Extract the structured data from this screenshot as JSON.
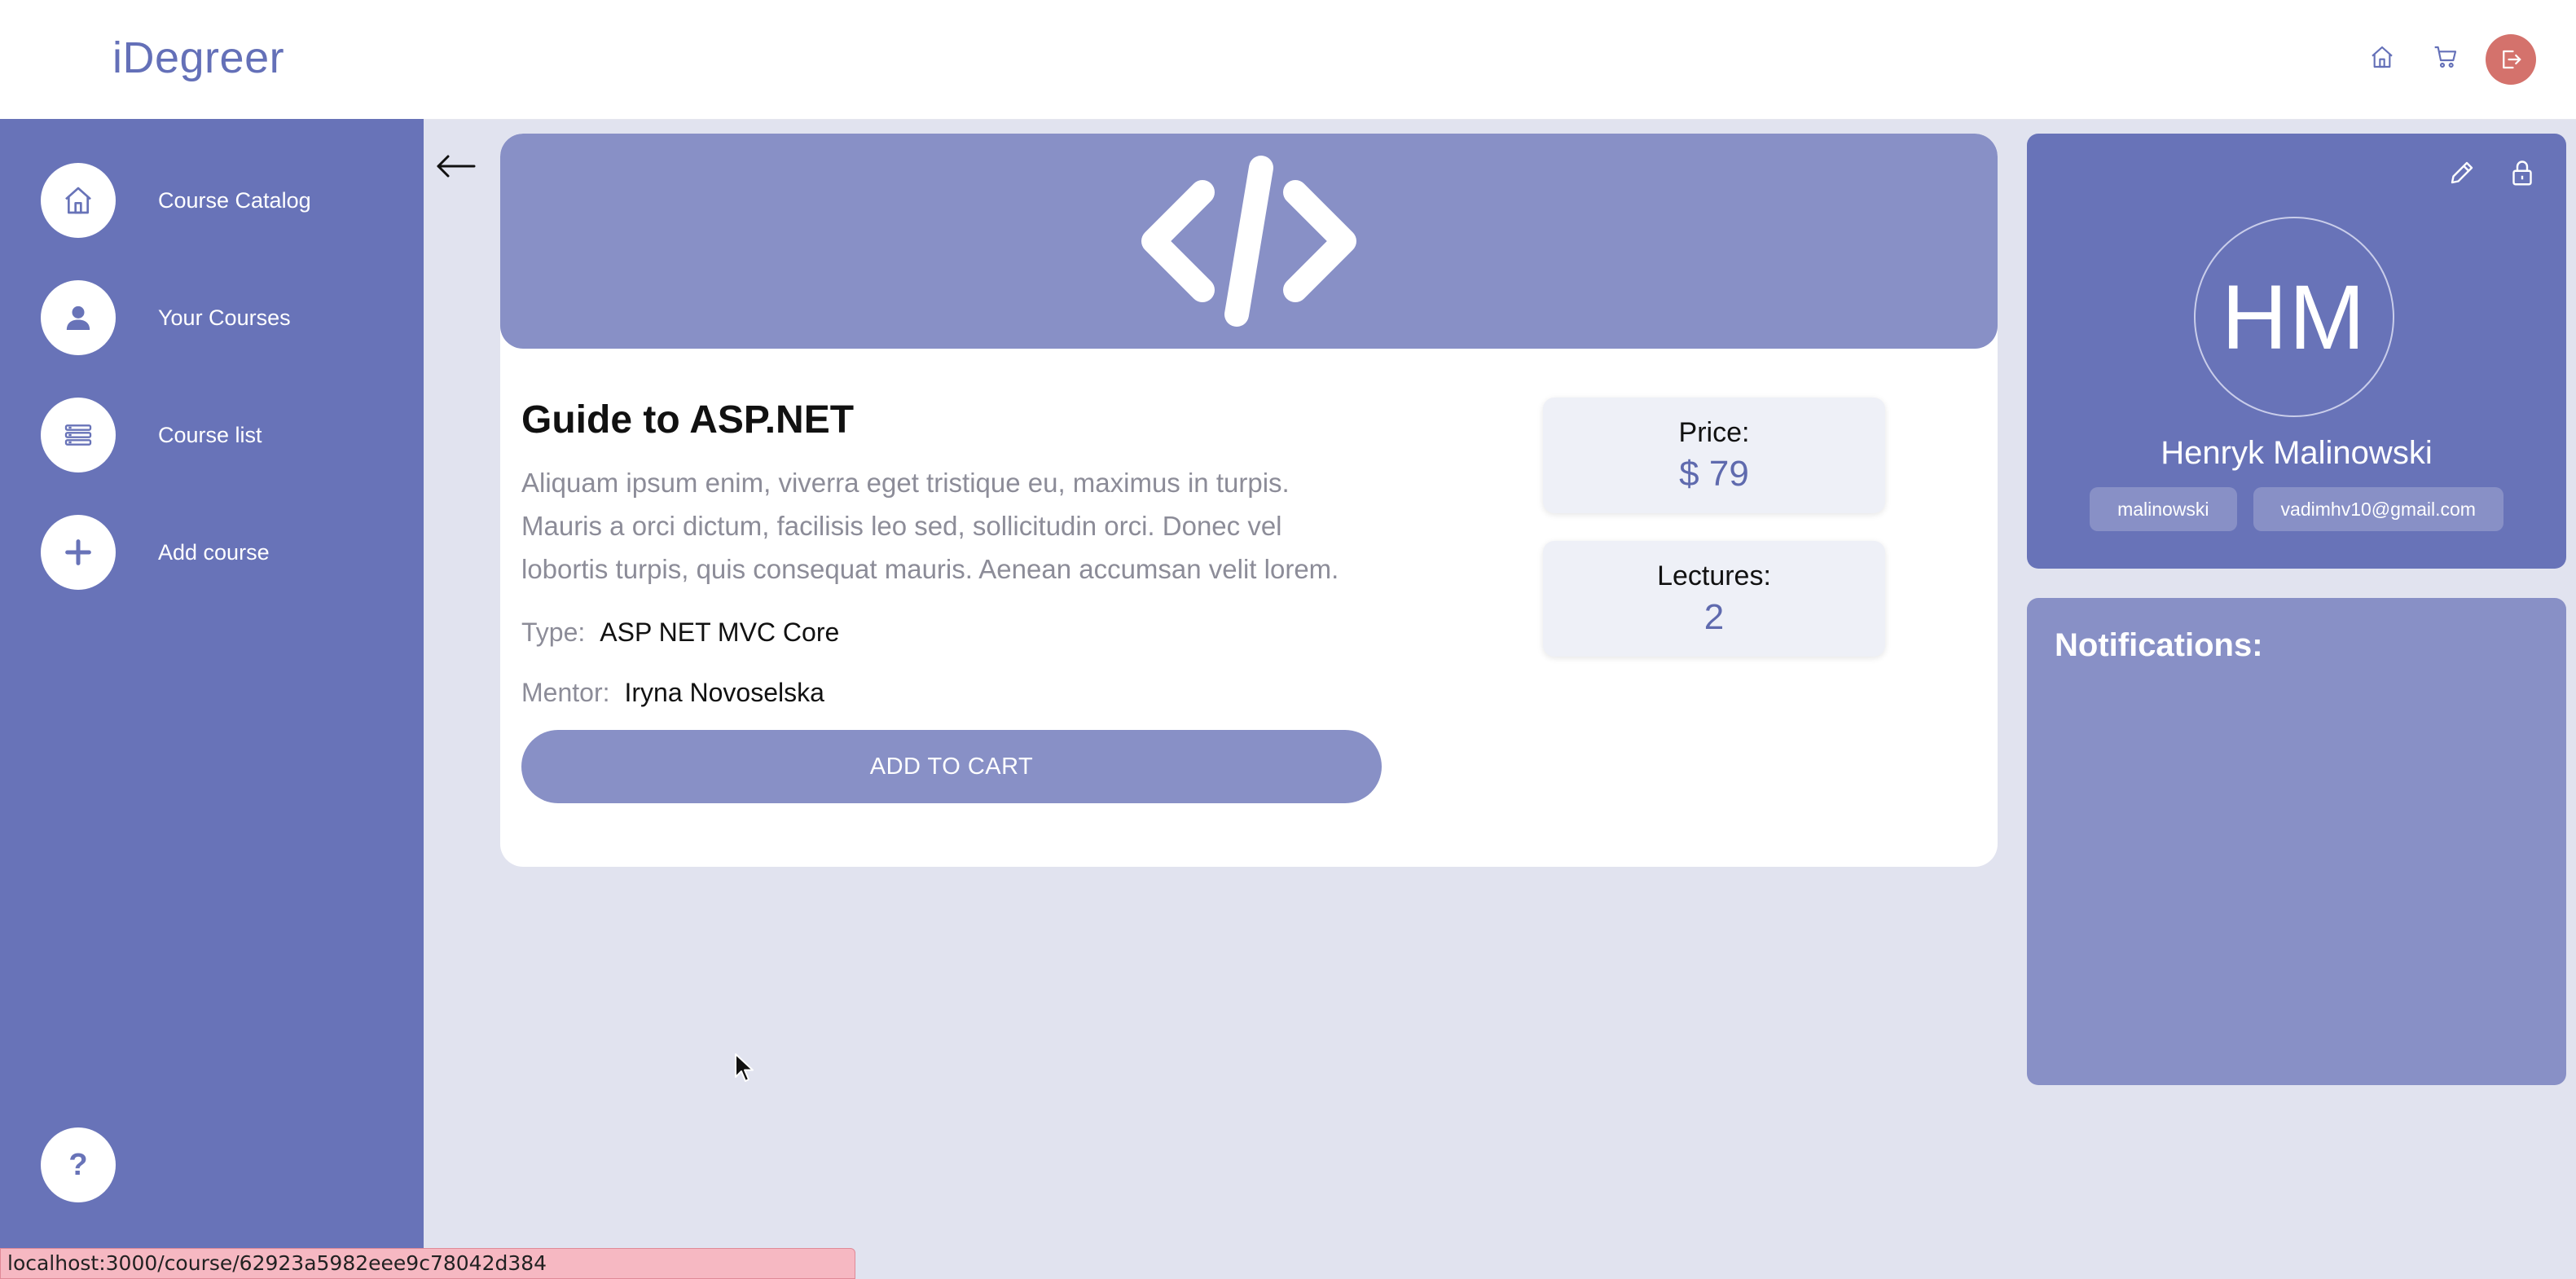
{
  "header": {
    "brand": "iDegreer",
    "icons": [
      "home-icon",
      "cart-icon",
      "logout-icon"
    ]
  },
  "sidebar": {
    "items": [
      {
        "label": "Course Catalog",
        "icon": "home-icon"
      },
      {
        "label": "Your Courses",
        "icon": "user-icon"
      },
      {
        "label": "Course list",
        "icon": "list-icon"
      },
      {
        "label": "Add course",
        "icon": "plus-icon"
      }
    ],
    "help_label": "?"
  },
  "course": {
    "banner_icon": "code-icon",
    "title": "Guide to ASP.NET",
    "description": "Aliquam ipsum enim, viverra eget tristique eu, maximus in turpis. Mauris a orci dictum, facilisis leo sed, sollicitudin orci. Donec vel lobortis turpis, quis consequat mauris. Aenean accumsan velit lorem.",
    "type_label": "Type:",
    "type_value": "ASP NET MVC Core",
    "mentor_label": "Mentor:",
    "mentor_value": "Iryna Novoselska",
    "add_to_cart_label": "ADD TO CART",
    "price_label": "Price:",
    "price_value": "$ 79",
    "lectures_label": "Lectures:",
    "lectures_value": "2"
  },
  "profile": {
    "initials": "HM",
    "name": "Henryk Malinowski",
    "username": "malinowski",
    "email": "vadimhv10@gmail.com"
  },
  "notifications": {
    "title": "Notifications:"
  },
  "status_bar": {
    "url": "localhost:3000/course/62923a5982eee9c78042d384"
  },
  "colors": {
    "accent": "#6873b8",
    "accent_light": "#8890c6",
    "background": "#e1e3ef",
    "logout": "#d4726c"
  }
}
